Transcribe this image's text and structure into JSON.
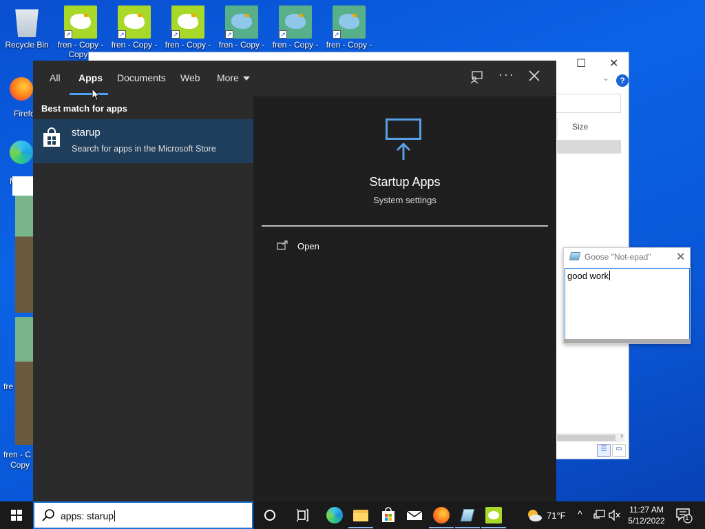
{
  "desktop": {
    "icons": [
      {
        "label": "Recycle Bin"
      },
      {
        "label": "fren - Copy -"
      },
      {
        "label": "fren - Copy -"
      },
      {
        "label": "fren - Copy -"
      },
      {
        "label": "fren - Copy -"
      },
      {
        "label": "fren - Copy -"
      },
      {
        "label": "fren - Copy -"
      }
    ],
    "partial_labels": {
      "copy_c": "Copy (",
      "firefox": "Firefo",
      "edge": "M",
      "fren_left": "fre",
      "fren_c": "fren - C",
      "copy": "Copy"
    }
  },
  "explorer": {
    "column_size": "Size",
    "help": "?"
  },
  "search": {
    "tabs": [
      {
        "label": "All"
      },
      {
        "label": "Apps"
      },
      {
        "label": "Documents"
      },
      {
        "label": "Web"
      },
      {
        "label": "More"
      }
    ],
    "best_match_heading": "Best match for apps",
    "result": {
      "title": "starup",
      "subtitle": "Search for apps in the Microsoft Store"
    },
    "preview": {
      "app_name": "Startup Apps",
      "app_type": "System settings",
      "actions": [
        {
          "label": "Open"
        }
      ]
    }
  },
  "notepad": {
    "title": "Goose \"Not-epad\"",
    "text": "good work"
  },
  "taskbar": {
    "search_query": "apps: starup",
    "weather_temp": "71°F",
    "time": "11:27 AM",
    "date": "5/12/2022",
    "notification_count": "1"
  },
  "colors": {
    "accent": "#4fa3f7",
    "selected_result": "#1e3e5c",
    "panel_bg": "#1f1f1f",
    "tab_bar_bg": "#2b2b2b",
    "desktop_blue": "#0b63e6"
  }
}
